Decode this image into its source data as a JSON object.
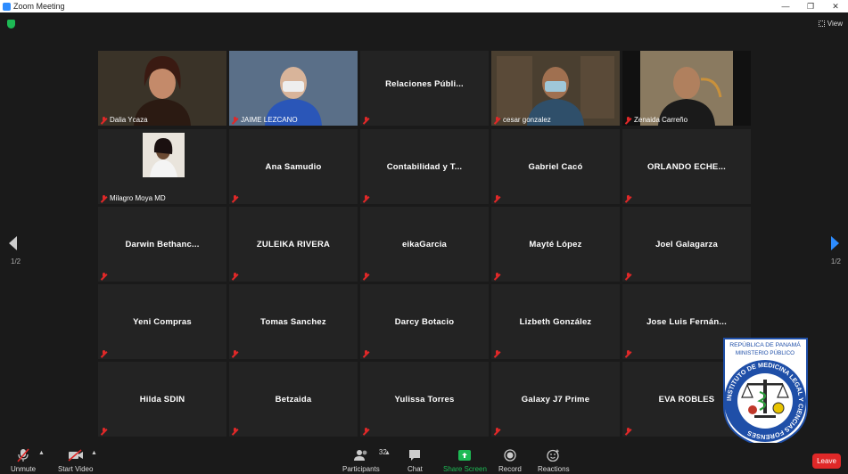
{
  "window": {
    "title": "Zoom Meeting"
  },
  "header": {
    "view_label": "View"
  },
  "gallery": {
    "page_left": "1/2",
    "page_right": "1/2",
    "tiles": [
      {
        "name": "Dalia Ycaza",
        "type": "video",
        "active": true
      },
      {
        "name": "JAIME LEZCANO",
        "type": "video"
      },
      {
        "name": "Relaciones  Públi...",
        "type": "text-top"
      },
      {
        "name": "cesar gonzalez",
        "type": "video"
      },
      {
        "name": "Zenaida Carreño",
        "type": "video"
      },
      {
        "name": "Milagro Moya MD",
        "type": "photo"
      },
      {
        "name": "Ana Samudio",
        "type": "text"
      },
      {
        "name": "Contabilidad y T...",
        "type": "text"
      },
      {
        "name": "Gabriel Cacó",
        "type": "text"
      },
      {
        "name": "ORLANDO  ECHE...",
        "type": "text"
      },
      {
        "name": "Darwin  Bethanc...",
        "type": "text"
      },
      {
        "name": "ZULEIKA RIVERA",
        "type": "text"
      },
      {
        "name": "eikaGarcia",
        "type": "text"
      },
      {
        "name": "Mayté López",
        "type": "text"
      },
      {
        "name": "Joel Galagarza",
        "type": "text"
      },
      {
        "name": "Yeni Compras",
        "type": "text"
      },
      {
        "name": "Tomas Sanchez",
        "type": "text"
      },
      {
        "name": "Darcy Botacio",
        "type": "text"
      },
      {
        "name": "Lizbeth González",
        "type": "text"
      },
      {
        "name": "Jose  Luis  Fernán...",
        "type": "text"
      },
      {
        "name": "Hilda SDIN",
        "type": "text"
      },
      {
        "name": "Betzaida",
        "type": "text"
      },
      {
        "name": "Yulissa Torres",
        "type": "text"
      },
      {
        "name": "Galaxy J7 Prime",
        "type": "text"
      },
      {
        "name": "EVA ROBLES",
        "type": "text"
      }
    ]
  },
  "overlay_logo": {
    "line1": "REPÚBLICA DE PANAMÁ",
    "line2": "MINISTERIO PÚBLICO",
    "ring_text": "INSTITUTO DE MEDICINA LEGAL Y CIENCIAS FORENSES"
  },
  "toolbar": {
    "unmute": "Unmute",
    "start_video": "Start Video",
    "participants": "Participants",
    "participants_count": "32",
    "chat": "Chat",
    "share_screen": "Share Screen",
    "record": "Record",
    "reactions": "Reactions",
    "leave": "Leave"
  },
  "colors": {
    "accent": "#d7f55a",
    "muted_red": "#e02828",
    "share_green": "#1db954",
    "brand_blue": "#2d8cff"
  }
}
